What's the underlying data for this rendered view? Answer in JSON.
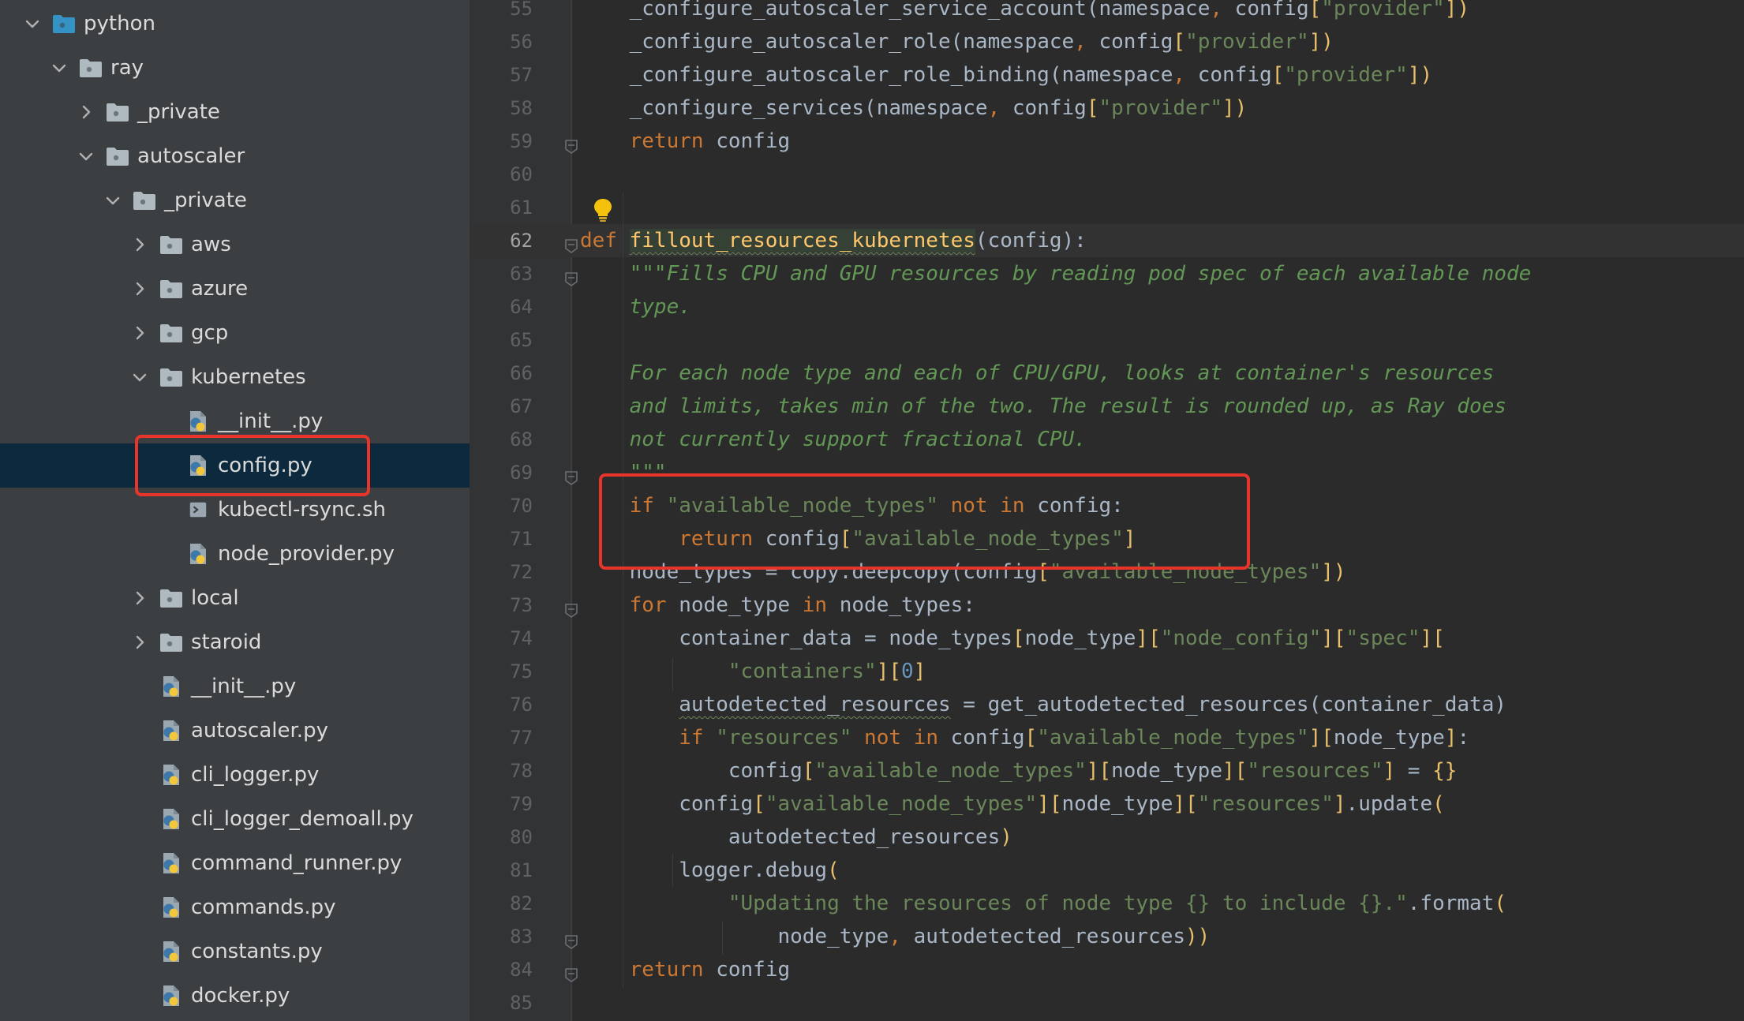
{
  "tree": {
    "items": [
      {
        "label": "python",
        "kind": "folder",
        "depth": 0,
        "expanded": true
      },
      {
        "label": "ray",
        "kind": "folder",
        "depth": 1,
        "expanded": true
      },
      {
        "label": "_private",
        "kind": "folder",
        "depth": 2,
        "expanded": false
      },
      {
        "label": "autoscaler",
        "kind": "folder",
        "depth": 2,
        "expanded": true
      },
      {
        "label": "_private",
        "kind": "folder",
        "depth": 3,
        "expanded": true
      },
      {
        "label": "aws",
        "kind": "folder",
        "depth": 4,
        "expanded": false
      },
      {
        "label": "azure",
        "kind": "folder",
        "depth": 4,
        "expanded": false
      },
      {
        "label": "gcp",
        "kind": "folder",
        "depth": 4,
        "expanded": false
      },
      {
        "label": "kubernetes",
        "kind": "folder",
        "depth": 4,
        "expanded": true
      },
      {
        "label": "__init__.py",
        "kind": "python-file",
        "depth": 5
      },
      {
        "label": "config.py",
        "kind": "python-file",
        "depth": 5,
        "selected": true
      },
      {
        "label": "kubectl-rsync.sh",
        "kind": "shell-file",
        "depth": 5
      },
      {
        "label": "node_provider.py",
        "kind": "python-file",
        "depth": 5
      },
      {
        "label": "local",
        "kind": "folder",
        "depth": 4,
        "expanded": false
      },
      {
        "label": "staroid",
        "kind": "folder",
        "depth": 4,
        "expanded": false
      },
      {
        "label": "__init__.py",
        "kind": "python-file",
        "depth": 4
      },
      {
        "label": "autoscaler.py",
        "kind": "python-file",
        "depth": 4
      },
      {
        "label": "cli_logger.py",
        "kind": "python-file",
        "depth": 4
      },
      {
        "label": "cli_logger_demoall.py",
        "kind": "python-file",
        "depth": 4
      },
      {
        "label": "command_runner.py",
        "kind": "python-file",
        "depth": 4
      },
      {
        "label": "commands.py",
        "kind": "python-file",
        "depth": 4
      },
      {
        "label": "constants.py",
        "kind": "python-file",
        "depth": 4
      },
      {
        "label": "docker.py",
        "kind": "python-file",
        "depth": 4
      }
    ]
  },
  "editor": {
    "current_line": 62,
    "lines": [
      {
        "n": "55",
        "fold": false,
        "tokens": [
          [
            "    ",
            ""
          ],
          [
            "_configure_autoscaler_service_account",
            ""
          ],
          [
            "(",
            ""
          ],
          [
            "namespace",
            ""
          ],
          [
            ", ",
            "pnc"
          ],
          [
            "config",
            ""
          ],
          [
            "[",
            "brk"
          ],
          [
            "\"provider\"",
            "str"
          ],
          [
            "])",
            "brk"
          ]
        ]
      },
      {
        "n": "56",
        "fold": false,
        "tokens": [
          [
            "    ",
            ""
          ],
          [
            "_configure_autoscaler_role",
            ""
          ],
          [
            "(",
            ""
          ],
          [
            "namespace",
            ""
          ],
          [
            ", ",
            "pnc"
          ],
          [
            "config",
            ""
          ],
          [
            "[",
            "brk"
          ],
          [
            "\"provider\"",
            "str"
          ],
          [
            "])",
            "brk"
          ]
        ]
      },
      {
        "n": "57",
        "fold": false,
        "tokens": [
          [
            "    ",
            ""
          ],
          [
            "_configure_autoscaler_role_binding",
            ""
          ],
          [
            "(",
            ""
          ],
          [
            "namespace",
            ""
          ],
          [
            ", ",
            "pnc"
          ],
          [
            "config",
            ""
          ],
          [
            "[",
            "brk"
          ],
          [
            "\"provider\"",
            "str"
          ],
          [
            "])",
            "brk"
          ]
        ]
      },
      {
        "n": "58",
        "fold": false,
        "tokens": [
          [
            "    ",
            ""
          ],
          [
            "_configure_services",
            ""
          ],
          [
            "(",
            ""
          ],
          [
            "namespace",
            ""
          ],
          [
            ", ",
            "pnc"
          ],
          [
            "config",
            ""
          ],
          [
            "[",
            "brk"
          ],
          [
            "\"provider\"",
            "str"
          ],
          [
            "])",
            "brk"
          ]
        ]
      },
      {
        "n": "59",
        "fold": true,
        "tokens": [
          [
            "    ",
            ""
          ],
          [
            "return",
            "kw"
          ],
          [
            " config",
            ""
          ]
        ]
      },
      {
        "n": "60",
        "fold": false,
        "tokens": []
      },
      {
        "n": "61",
        "fold": false,
        "tokens": []
      },
      {
        "n": "62",
        "fold": true,
        "tokens": [
          [
            "def",
            "kw"
          ],
          [
            " ",
            ""
          ],
          [
            "fillout_resources_kubernetes",
            "def-name"
          ],
          [
            "(config):",
            ""
          ]
        ]
      },
      {
        "n": "63",
        "fold": true,
        "tokens": [
          [
            "    ",
            ""
          ],
          [
            "\"\"\"Fills CPU and GPU resources by reading pod spec of each available node",
            "doc"
          ]
        ]
      },
      {
        "n": "64",
        "fold": false,
        "tokens": [
          [
            "    ",
            ""
          ],
          [
            "type.",
            "doc"
          ]
        ]
      },
      {
        "n": "65",
        "fold": false,
        "tokens": []
      },
      {
        "n": "66",
        "fold": false,
        "tokens": [
          [
            "    ",
            ""
          ],
          [
            "For each node type and each of CPU/GPU, looks at container's resources",
            "doc"
          ]
        ]
      },
      {
        "n": "67",
        "fold": false,
        "tokens": [
          [
            "    ",
            ""
          ],
          [
            "and limits, takes min of the two. The result is rounded up, as Ray does",
            "doc"
          ]
        ]
      },
      {
        "n": "68",
        "fold": false,
        "tokens": [
          [
            "    ",
            ""
          ],
          [
            "not currently support fractional CPU.",
            "doc"
          ]
        ]
      },
      {
        "n": "69",
        "fold": true,
        "tokens": [
          [
            "    ",
            ""
          ],
          [
            "\"\"\"",
            "doc"
          ]
        ]
      },
      {
        "n": "70",
        "fold": false,
        "tokens": [
          [
            "    ",
            ""
          ],
          [
            "if",
            "kw"
          ],
          [
            " ",
            ""
          ],
          [
            "\"available_node_types\"",
            "str"
          ],
          [
            " ",
            ""
          ],
          [
            "not in",
            "kw"
          ],
          [
            " config:",
            ""
          ]
        ]
      },
      {
        "n": "71",
        "fold": false,
        "tokens": [
          [
            "        ",
            ""
          ],
          [
            "return",
            "kw"
          ],
          [
            " config",
            ""
          ],
          [
            "[",
            "brk"
          ],
          [
            "\"available_node_types\"",
            "str"
          ],
          [
            "]",
            "brk"
          ]
        ]
      },
      {
        "n": "72",
        "fold": false,
        "tokens": [
          [
            "    ",
            ""
          ],
          [
            "node_types = copy.deepcopy(config",
            ""
          ],
          [
            "[",
            "brk"
          ],
          [
            "\"available_node_types\"",
            "str"
          ],
          [
            "])",
            "brk"
          ]
        ]
      },
      {
        "n": "73",
        "fold": true,
        "tokens": [
          [
            "    ",
            ""
          ],
          [
            "for",
            "kw"
          ],
          [
            " node_type ",
            ""
          ],
          [
            "in",
            "kw"
          ],
          [
            " node_types:",
            ""
          ]
        ]
      },
      {
        "n": "74",
        "fold": false,
        "tokens": [
          [
            "        ",
            ""
          ],
          [
            "container_data = node_types",
            ""
          ],
          [
            "[",
            "brk"
          ],
          [
            "node_type",
            ""
          ],
          [
            "][",
            "brk"
          ],
          [
            "\"node_config\"",
            "str"
          ],
          [
            "][",
            "brk"
          ],
          [
            "\"spec\"",
            "str"
          ],
          [
            "][",
            "brk"
          ]
        ]
      },
      {
        "n": "75",
        "fold": false,
        "tokens": [
          [
            "            ",
            ""
          ],
          [
            "\"containers\"",
            "str"
          ],
          [
            "][",
            "brk"
          ],
          [
            "0",
            "num"
          ],
          [
            "]",
            "brk"
          ]
        ]
      },
      {
        "n": "76",
        "fold": false,
        "tokens": [
          [
            "        ",
            ""
          ],
          [
            "autodetected_resources",
            "wavy"
          ],
          [
            " = get_autodetected_resources",
            ""
          ],
          [
            "(",
            ""
          ],
          [
            "container_data",
            ""
          ],
          [
            ")",
            ""
          ]
        ]
      },
      {
        "n": "77",
        "fold": false,
        "tokens": [
          [
            "        ",
            ""
          ],
          [
            "if",
            "kw"
          ],
          [
            " ",
            ""
          ],
          [
            "\"resources\"",
            "str"
          ],
          [
            " ",
            ""
          ],
          [
            "not in",
            "kw"
          ],
          [
            " config",
            ""
          ],
          [
            "[",
            "brk"
          ],
          [
            "\"available_node_types\"",
            "str"
          ],
          [
            "][",
            "brk"
          ],
          [
            "node_type",
            ""
          ],
          [
            "]",
            "brk"
          ],
          [
            ":",
            ""
          ]
        ]
      },
      {
        "n": "78",
        "fold": false,
        "tokens": [
          [
            "            ",
            ""
          ],
          [
            "config",
            ""
          ],
          [
            "[",
            "brk"
          ],
          [
            "\"available_node_types\"",
            "str"
          ],
          [
            "][",
            "brk"
          ],
          [
            "node_type",
            ""
          ],
          [
            "][",
            "brk"
          ],
          [
            "\"resources\"",
            "str"
          ],
          [
            "]",
            "brk"
          ],
          [
            " = ",
            ""
          ],
          [
            "{}",
            "brk"
          ]
        ]
      },
      {
        "n": "79",
        "fold": false,
        "tokens": [
          [
            "        ",
            ""
          ],
          [
            "config",
            ""
          ],
          [
            "[",
            "brk"
          ],
          [
            "\"available_node_types\"",
            "str"
          ],
          [
            "][",
            "brk"
          ],
          [
            "node_type",
            ""
          ],
          [
            "][",
            "brk"
          ],
          [
            "\"resources\"",
            "str"
          ],
          [
            "]",
            "brk"
          ],
          [
            ".update",
            ""
          ],
          [
            "(",
            "brk"
          ]
        ]
      },
      {
        "n": "80",
        "fold": false,
        "tokens": [
          [
            "            ",
            ""
          ],
          [
            "autodetected_resources",
            ""
          ],
          [
            ")",
            "brk"
          ]
        ]
      },
      {
        "n": "81",
        "fold": false,
        "tokens": [
          [
            "        ",
            ""
          ],
          [
            "logger.debug",
            ""
          ],
          [
            "(",
            "brk"
          ]
        ]
      },
      {
        "n": "82",
        "fold": false,
        "tokens": [
          [
            "            ",
            ""
          ],
          [
            "\"Updating the resources of node type {} to include {}.\"",
            "str"
          ],
          [
            ".format",
            ""
          ],
          [
            "(",
            "brk"
          ]
        ]
      },
      {
        "n": "83",
        "fold": true,
        "tokens": [
          [
            "                ",
            ""
          ],
          [
            "node_type",
            ""
          ],
          [
            ", ",
            "pnc"
          ],
          [
            "autodetected_resources",
            ""
          ],
          [
            "))",
            "brk"
          ]
        ]
      },
      {
        "n": "84",
        "fold": true,
        "tokens": [
          [
            "    ",
            ""
          ],
          [
            "return",
            "kw"
          ],
          [
            " config",
            ""
          ]
        ]
      },
      {
        "n": "85",
        "fold": false,
        "tokens": []
      }
    ]
  },
  "icons": {
    "folder": "folder-icon",
    "python-file": "python-file-icon",
    "shell-file": "shell-file-icon",
    "expanded": "chevron-down-icon",
    "collapsed": "chevron-right-icon",
    "intention": "lightbulb-icon"
  },
  "colors": {
    "highlight_box": "#e8352b",
    "keyword": "#cc7832",
    "string": "#6a8759",
    "docstring": "#629755",
    "function": "#ffc66d"
  }
}
